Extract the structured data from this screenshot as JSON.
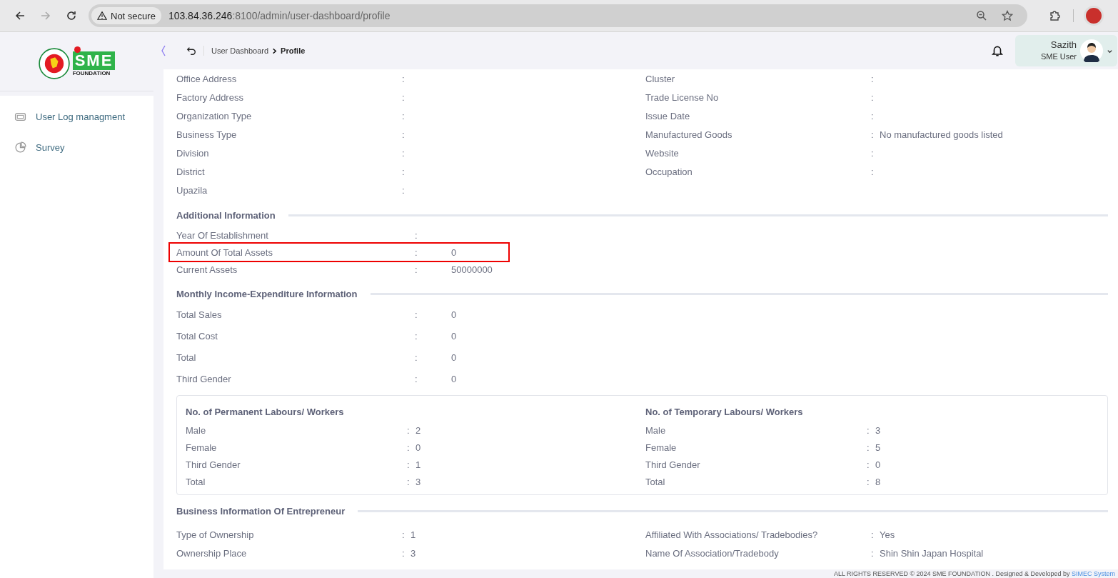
{
  "browser": {
    "security": "Not secure",
    "url_host": "103.84.36.246",
    "url_path": ":8100/admin/user-dashboard/profile"
  },
  "logo": {
    "mark": "SME",
    "caption": "FOUNDATION"
  },
  "breadcrumb": [
    {
      "label": "User Dashboard",
      "current": false
    },
    {
      "label": "Profile",
      "current": true
    }
  ],
  "user": {
    "name": "Sazith",
    "role": "SME User"
  },
  "sidebar": {
    "items": [
      {
        "label": "User Log managment",
        "kind": "log"
      },
      {
        "label": "Survey",
        "kind": "chart"
      }
    ]
  },
  "basic_info": {
    "left": [
      {
        "label": "Office Address",
        "sep": ":"
      },
      {
        "label": "Factory Address",
        "sep": ":"
      },
      {
        "label": "Organization Type",
        "sep": ":"
      },
      {
        "label": "Business Type",
        "sep": ":"
      },
      {
        "label": "Division",
        "sep": ":"
      },
      {
        "label": "District",
        "sep": ":"
      },
      {
        "label": "Upazila",
        "sep": ":"
      }
    ],
    "right": [
      {
        "label": "Cluster",
        "sep": ":"
      },
      {
        "label": "Trade License No",
        "sep": ":"
      },
      {
        "label": "Issue Date",
        "sep": ":"
      },
      {
        "label": "Manufactured Goods",
        "sep": ":",
        "value": "No manufactured goods listed"
      },
      {
        "label": "Website",
        "sep": ":"
      },
      {
        "label": "Occupation",
        "sep": ":"
      }
    ]
  },
  "additional": {
    "title": "Additional Information",
    "rows": [
      {
        "label": "Year Of Establishment",
        "sep": ":",
        "highlighted": false
      },
      {
        "label": "Amount Of Total Assets",
        "sep": ":",
        "value": "0",
        "highlighted": true
      },
      {
        "label": "Current Assets",
        "sep": ":",
        "value": "50000000",
        "highlighted": false
      }
    ]
  },
  "monthly": {
    "title": "Monthly Income-Expenditure Information",
    "rows": [
      {
        "label": "Total Sales",
        "sep": ":",
        "value": "0"
      },
      {
        "label": "Total Cost",
        "sep": ":",
        "value": "0"
      },
      {
        "label": "Total",
        "sep": ":",
        "value": "0"
      },
      {
        "label": "Third Gender",
        "sep": ":",
        "value": "0"
      }
    ]
  },
  "labours": [
    {
      "title": "No. of Permanent Labours/ Workers",
      "rows": [
        {
          "label": "Male",
          "sep": ":",
          "value": "2"
        },
        {
          "label": "Female",
          "sep": ":",
          "value": "0"
        },
        {
          "label": "Third Gender",
          "sep": ":",
          "value": "1"
        },
        {
          "label": "Total",
          "sep": ":",
          "value": "3"
        }
      ]
    },
    {
      "title": "No. of Temporary Labours/ Workers",
      "rows": [
        {
          "label": "Male",
          "sep": ":",
          "value": "3"
        },
        {
          "label": "Female",
          "sep": ":",
          "value": "5"
        },
        {
          "label": "Third Gender",
          "sep": ":",
          "value": "0"
        },
        {
          "label": "Total",
          "sep": ":",
          "value": "8"
        }
      ]
    }
  ],
  "business": {
    "title": "Business Information Of Entrepreneur",
    "left": [
      {
        "label": "Type of Ownership",
        "sep": ":",
        "value": "1"
      },
      {
        "label": "Ownership Place",
        "sep": ":",
        "value": "3"
      }
    ],
    "right": [
      {
        "label": "Affiliated With Associations/ Tradebodies?",
        "sep": ":",
        "value": "Yes"
      },
      {
        "label": "Name Of Association/Tradebody",
        "sep": ":",
        "value": "Shin Shin Japan Hospital"
      }
    ]
  },
  "footer": {
    "text": "ALL RIGHTS RESERVED © 2024 SME FOUNDATION . Designed & Developed by",
    "link": "SIMEC System"
  }
}
